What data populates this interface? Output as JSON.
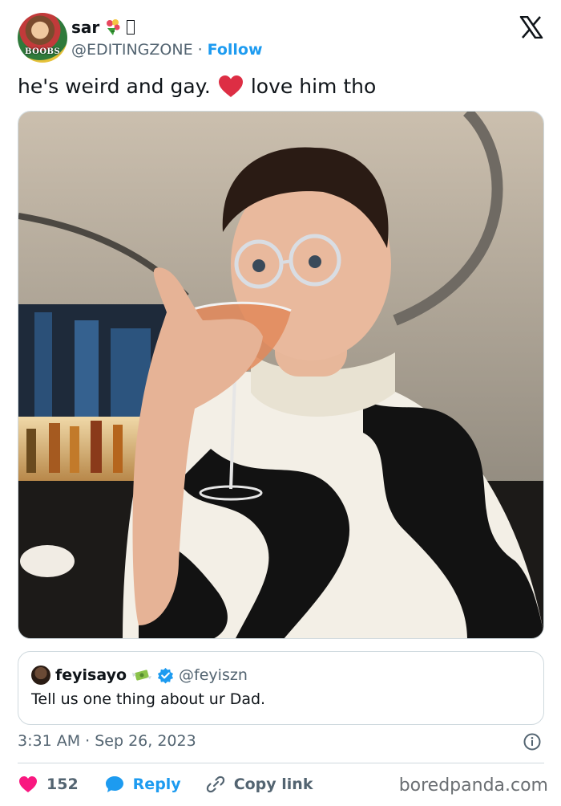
{
  "author": {
    "display_name": "sar",
    "handle": "@EDITINGZONE",
    "separator": "·",
    "follow_label": "Follow",
    "avatar_text": "BOOBS"
  },
  "tweet": {
    "text_before": "he's weird and gay.",
    "text_after": "love him tho",
    "timestamp": "3:31 AM · Sep 26, 2023"
  },
  "quote": {
    "display_name": "feyisayo",
    "handle": "@feyiszn",
    "text": "Tell us one thing about ur Dad."
  },
  "actions": {
    "like_count": "152",
    "reply_label": "Reply",
    "copy_link_label": "Copy link"
  },
  "watermark": "boredpanda.com",
  "colors": {
    "accent": "#1d9bf0",
    "like": "#f91880",
    "muted": "#536471"
  }
}
